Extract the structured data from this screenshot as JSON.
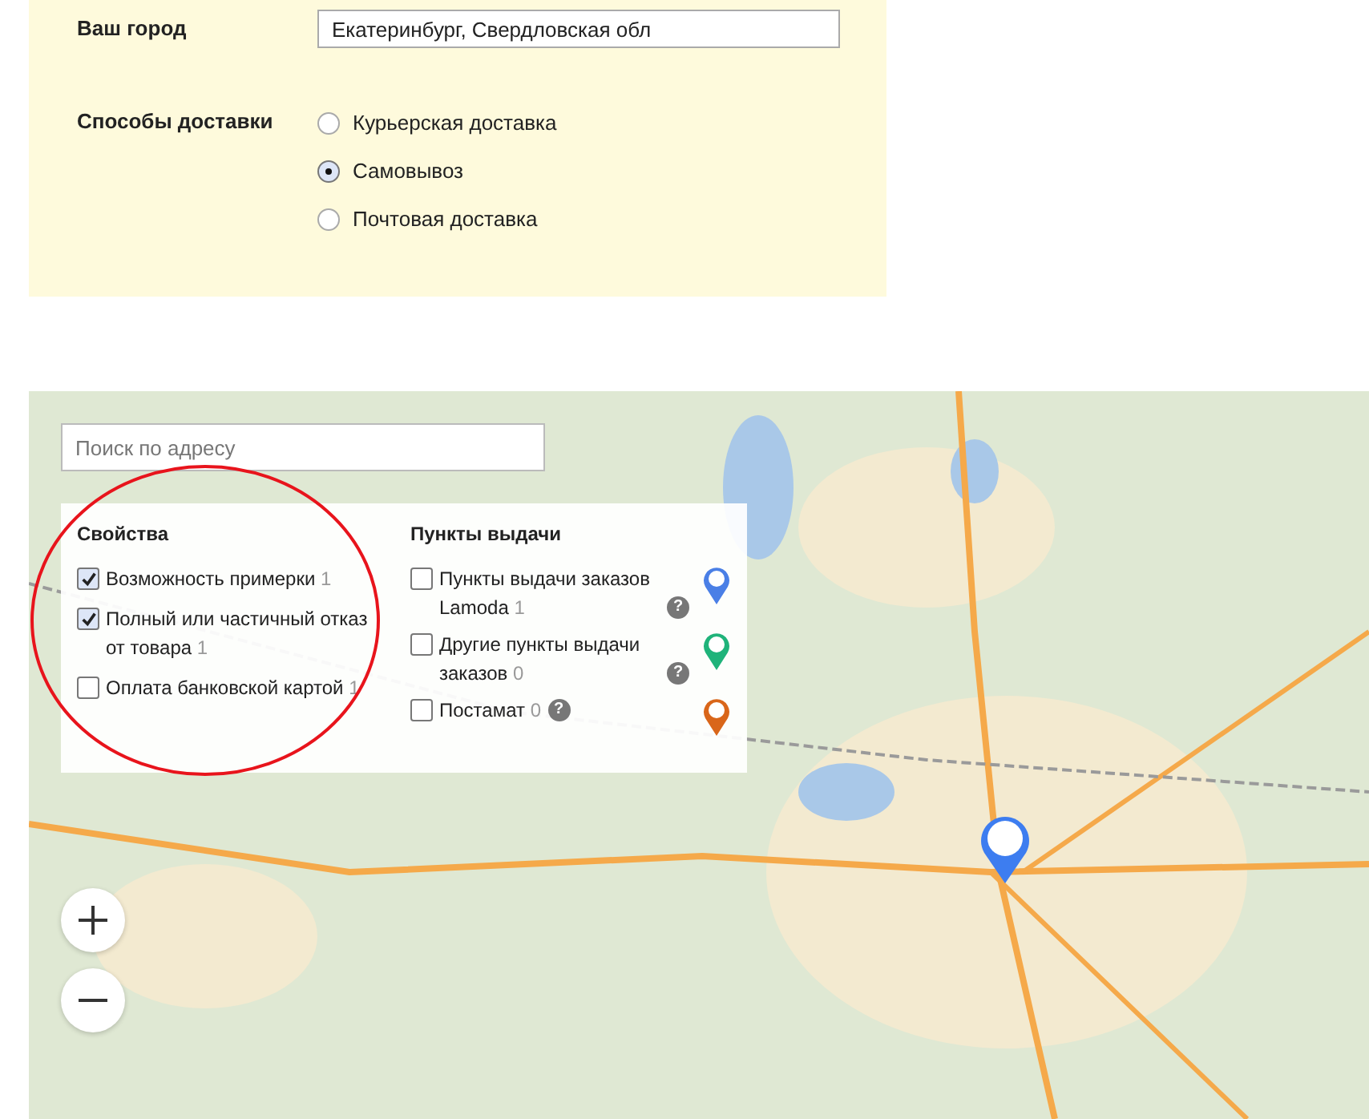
{
  "form": {
    "city": {
      "label": "Ваш город",
      "value": "Екатеринбург, Свердловская обл"
    },
    "delivery": {
      "label": "Способы доставки",
      "options": [
        {
          "label": "Курьерская доставка",
          "selected": false
        },
        {
          "label": "Самовывоз",
          "selected": true
        },
        {
          "label": "Почтовая доставка",
          "selected": false
        }
      ]
    }
  },
  "map": {
    "search": {
      "placeholder": "Поиск по адресу"
    },
    "filters": {
      "properties": {
        "title": "Свойства",
        "items": [
          {
            "label": "Возможность примерки",
            "count": "1",
            "checked": true
          },
          {
            "label": "Полный или частичный отказ от товара",
            "count": "1",
            "checked": true
          },
          {
            "label": "Оплата банковской картой",
            "count": "1",
            "checked": false
          }
        ]
      },
      "pickup": {
        "title": "Пункты выдачи",
        "items": [
          {
            "label": "Пункты выдачи заказов Lamoda",
            "count": "1",
            "help": "?",
            "checked": false,
            "color": "#4a7fe6"
          },
          {
            "label": "Другие пункты выдачи заказов",
            "count": "0",
            "help": "?",
            "checked": false,
            "color": "#1fb37a"
          },
          {
            "label": "Постамат",
            "count": "0",
            "help": "?",
            "checked": false,
            "color": "#d9661a"
          }
        ]
      }
    }
  }
}
